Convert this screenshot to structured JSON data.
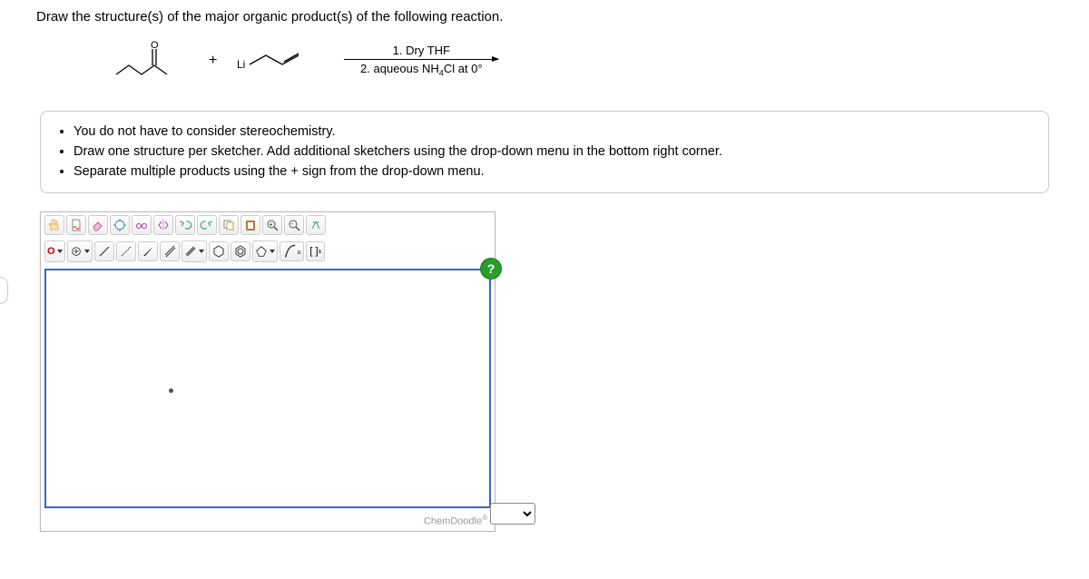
{
  "question": "Draw the structure(s) of the major organic product(s) of the following reaction.",
  "reaction": {
    "plus": "+",
    "reagent_label": "Li",
    "cond_top": "1. Dry THF",
    "cond_bot_pre": "2. aqueous NH",
    "cond_bot_sub": "4",
    "cond_bot_post": "Cl at 0°"
  },
  "instructions": {
    "i1": "You do not have to consider stereochemistry.",
    "i2": "Draw one structure per sketcher. Add additional sketchers using the drop-down menu in the bottom right corner.",
    "i3": "Separate multiple products using the + sign from the drop-down menu."
  },
  "sketcher": {
    "letter_o": "O",
    "polymer_n": "n",
    "brackets": "[ ]",
    "charge": "±",
    "help": "?",
    "brand_pre": "ChemDoodle",
    "brand_sup": "®"
  }
}
